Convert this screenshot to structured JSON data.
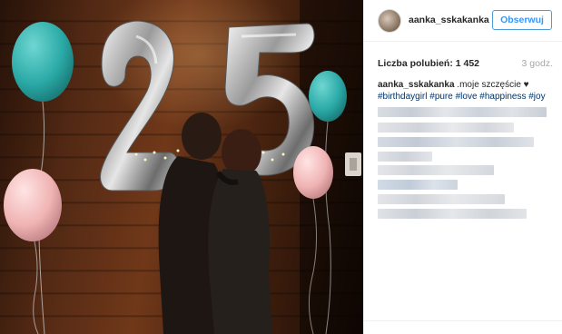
{
  "post": {
    "username": "aanka_sskakanka",
    "follow_label": "Obserwuj",
    "likes_label": "Liczba polubień: 1 452",
    "time_ago": "3 godz.",
    "caption": {
      "username": "aanka_sskakanka",
      "text": " .moje szczęście ",
      "heart_icon": "black-heart-icon",
      "tags": "#birthdaygirl #pure #love #happiness #joy"
    }
  },
  "colors": {
    "follow_blue": "#3897f0",
    "hashtag_blue": "#003569",
    "time_gray": "#a5a7aa",
    "balloon_teal": "#2fb3b0",
    "balloon_pink": "#f2b6b6"
  }
}
